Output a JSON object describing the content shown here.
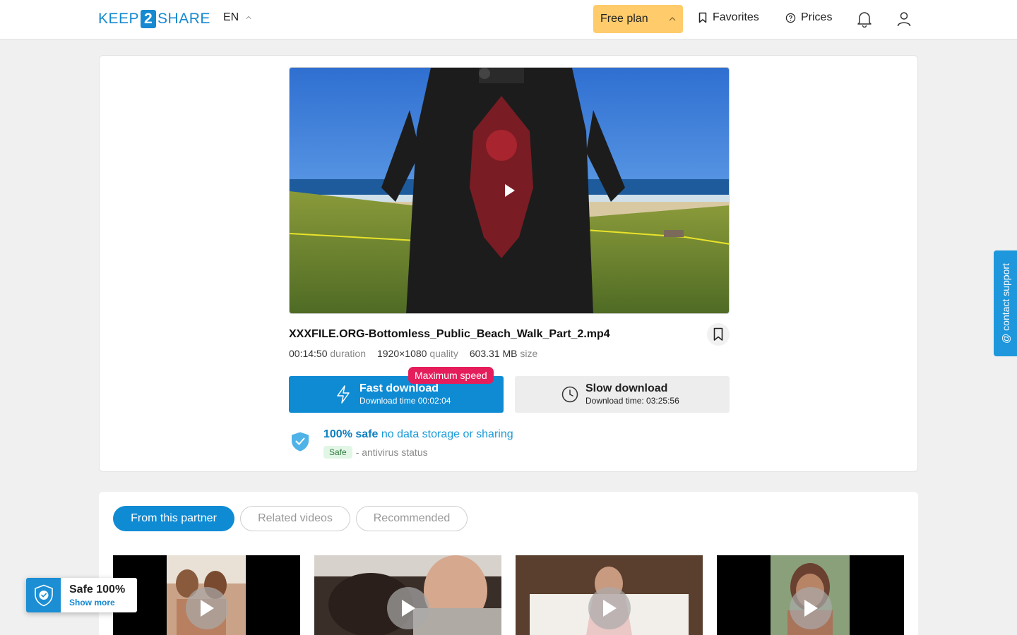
{
  "header": {
    "logo_left": "KEEP",
    "logo_num": "2",
    "logo_right": "SHARE",
    "lang": "EN",
    "plan_label": "Free plan",
    "favorites_label": "Favorites",
    "prices_label": "Prices"
  },
  "file": {
    "name": "XXXFILE.ORG-Bottomless_Public_Beach_Walk_Part_2.mp4",
    "duration": "00:14:50",
    "duration_label": "duration",
    "quality": "1920×1080",
    "quality_label": "quality",
    "size": "603.31 MB",
    "size_label": "size"
  },
  "download": {
    "badge": "Maximum speed",
    "fast_title": "Fast download",
    "fast_sub": "Download time 00:02:04",
    "slow_title": "Slow download",
    "slow_sub": "Download time: 03:25:56"
  },
  "safety": {
    "strong": "100% safe",
    "light": "no data storage or sharing",
    "pill": "Safe",
    "status": "- antivirus status"
  },
  "support_label": "@ contact support",
  "tabs": [
    "From this partner",
    "Related videos",
    "Recommended"
  ],
  "widget": {
    "title": "Safe 100%",
    "link": "Show more"
  },
  "colors": {
    "primary": "#0f8bd4",
    "plan": "#ffcb6b",
    "badge": "#e51e5b"
  }
}
